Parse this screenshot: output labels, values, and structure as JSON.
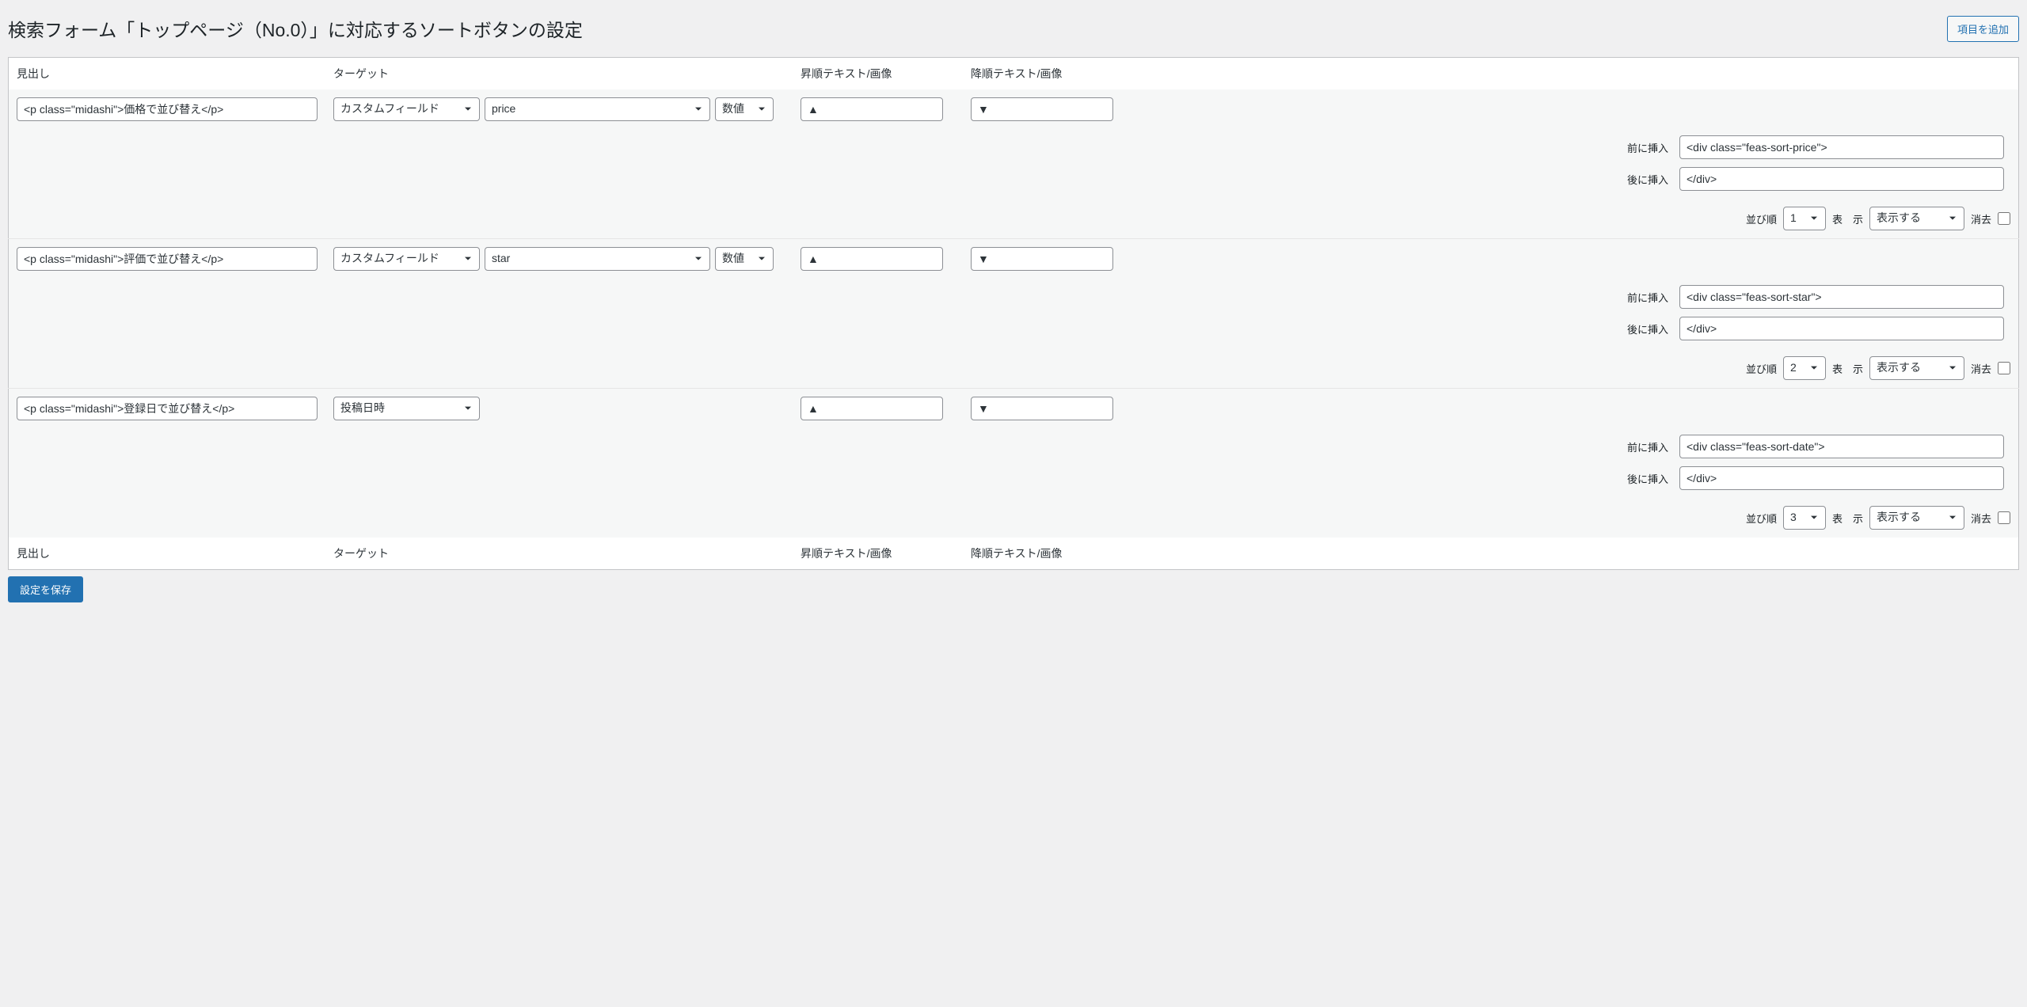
{
  "header": {
    "title": "検索フォーム「トップページ（No.0）」に対応するソートボタンの設定",
    "add_button": "項目を追加"
  },
  "columns": {
    "heading": "見出し",
    "target": "ターゲット",
    "asc": "昇順テキスト/画像",
    "desc": "降順テキスト/画像"
  },
  "labels": {
    "insert_before": "前に挿入",
    "insert_after": "後に挿入",
    "order": "並び順",
    "display": "表　示",
    "delete": "消去"
  },
  "options": {
    "target_type": "カスタムフィールド",
    "value_type": "数値",
    "display_option": "表示する"
  },
  "rows": [
    {
      "heading": "<p class=\"midashi\">価格で並び替え</p>",
      "target_type": "カスタムフィールド",
      "target_field": "price",
      "value_type": "数値",
      "asc_text": "▲",
      "desc_text": "▼",
      "insert_before": "<div class=\"feas-sort-price\">",
      "insert_after": "</div>",
      "order": "1",
      "display": "表示する"
    },
    {
      "heading": "<p class=\"midashi\">評価で並び替え</p>",
      "target_type": "カスタムフィールド",
      "target_field": "star",
      "value_type": "数値",
      "asc_text": "▲",
      "desc_text": "▼",
      "insert_before": "<div class=\"feas-sort-star\">",
      "insert_after": "</div>",
      "order": "2",
      "display": "表示する"
    },
    {
      "heading": "<p class=\"midashi\">登録日で並び替え</p>",
      "target_type": "投稿日時",
      "target_field": "",
      "value_type": "",
      "asc_text": "▲",
      "desc_text": "▼",
      "insert_before": "<div class=\"feas-sort-date\">",
      "insert_after": "</div>",
      "order": "3",
      "display": "表示する"
    }
  ],
  "save_button": "設定を保存"
}
